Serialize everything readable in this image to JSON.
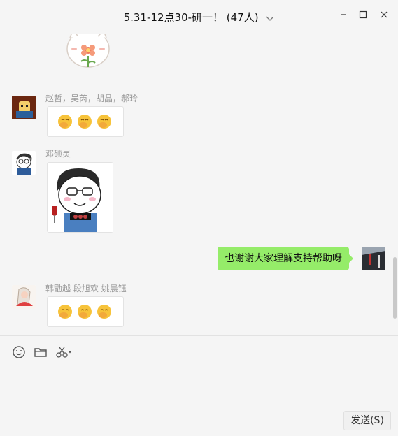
{
  "window": {
    "title": "5.31-12点30-研一！ (47人)",
    "min_icon": "minimize-icon",
    "max_icon": "maximize-icon",
    "close_icon": "close-icon"
  },
  "messages": [
    {
      "type": "sticker",
      "sender_names": "",
      "sticker": "cat-flower-sticker"
    },
    {
      "type": "emoji",
      "sender_names": "赵哲，吴芮，胡晶，郝玲",
      "emoji": [
        "hand-over-mouth-emoji",
        "hand-over-mouth-emoji",
        "hand-over-mouth-emoji"
      ]
    },
    {
      "type": "sticker",
      "sender_names": "邓硕灵",
      "sticker": "cartoon-man-sticker"
    },
    {
      "type": "text",
      "self": true,
      "text": "也谢谢大家理解支持帮助呀"
    },
    {
      "type": "emoji",
      "sender_names": "韩勖越 段旭欢 姚晨钰",
      "emoji": [
        "hand-over-mouth-emoji",
        "hand-over-mouth-emoji",
        "hand-over-mouth-emoji"
      ]
    }
  ],
  "toolbar": {
    "emoji_icon": "smiley-icon",
    "file_icon": "folder-icon",
    "screenshot_icon": "scissors-icon"
  },
  "send_label": "发送(S)",
  "colors": {
    "self_bubble": "#95ec69",
    "background": "#f5f5f5"
  }
}
